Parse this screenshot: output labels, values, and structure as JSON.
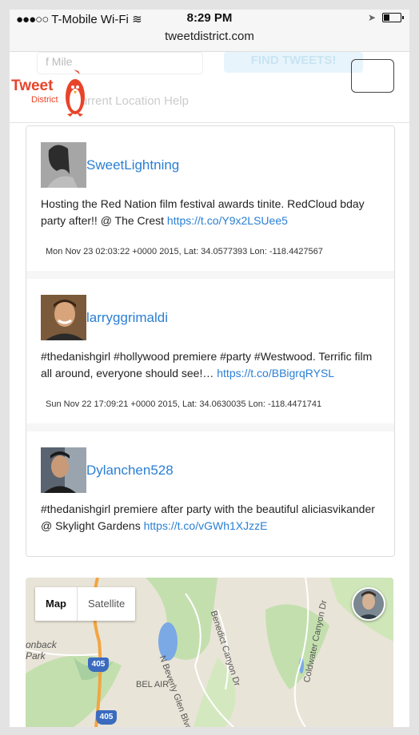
{
  "status": {
    "carrier": "T-Mobile Wi-Fi",
    "time": "8:29 PM",
    "url": "tweetdistrict.com"
  },
  "header": {
    "ghost_input": "f Mile",
    "ghost_button": "FIND TWEETS!",
    "ghost_help": "Current Location Help",
    "logo_word": "Tweet",
    "logo_sub": "District"
  },
  "tweets": [
    {
      "user": "SweetLightning",
      "text": "Hosting the Red Nation film festival awards tinite. RedCloud bday party after!! @ The Crest",
      "link": "https://t.co/Y9x2LSUee5",
      "meta": "Mon Nov 23 02:03:22 +0000 2015, Lat: 34.0577393 Lon: -118.4427567"
    },
    {
      "user": "larryggrimaldi",
      "text": "#thedanishgirl #hollywood premiere #party #Westwood. Terrific film all around, everyone should see!…",
      "link": "https://t.co/BBigrqRYSL",
      "meta": "Sun Nov 22 17:09:21 +0000 2015, Lat: 34.0630035 Lon: -118.4471741"
    },
    {
      "user": "Dylanchen528",
      "text": "#thedanishgirl premiere after party with the beautiful aliciasvikander @ Skylight Gardens",
      "link": "https://t.co/vGWh1XJzzE",
      "meta": ""
    }
  ],
  "map": {
    "map_label": "Map",
    "satellite_label": "Satellite",
    "labels": {
      "onback": "onback",
      "park": "Park",
      "bel_air": "BEL AIR",
      "beverly_glen": "N Beverly Glen Blvd",
      "benedict": "Benedict Canyon Dr",
      "coldwater": "Coldwater Canyon Dr",
      "shield1": "405",
      "shield2": "405"
    }
  }
}
